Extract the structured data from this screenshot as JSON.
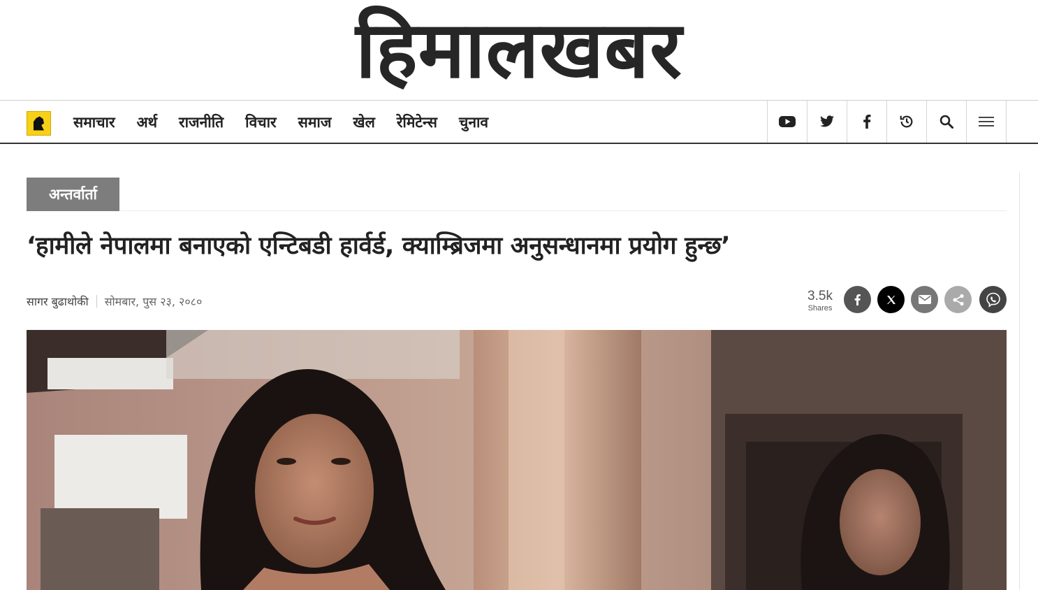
{
  "masthead": {
    "logo_text": "हिमालखबर"
  },
  "nav": {
    "items": [
      "समाचार",
      "अर्थ",
      "राजनीति",
      "विचार",
      "समाज",
      "खेल",
      "रेमिटेन्स",
      "चुनाव"
    ],
    "icons": [
      "youtube-icon",
      "twitter-icon",
      "facebook-icon",
      "history-icon",
      "search-icon",
      "menu-icon"
    ]
  },
  "article": {
    "category": "अन्तर्वार्ता",
    "headline": "‘हामीले नेपालमा बनाएको एन्टिबडी हार्वर्ड, क्याम्ब्रिजमा अनुसन्धानमा प्रयोग हुन्छ’",
    "author": "सागर बुढाथोकी",
    "date": "सोमबार, पुस २३, २०८०"
  },
  "share": {
    "count": "3.5k",
    "label": "Shares",
    "buttons": [
      {
        "name": "facebook-share",
        "color": "#555555"
      },
      {
        "name": "x-share",
        "color": "#000000"
      },
      {
        "name": "email-share",
        "color": "#777777"
      },
      {
        "name": "generic-share",
        "color": "#aaaaaa"
      },
      {
        "name": "viber-share",
        "color": "#444444"
      }
    ]
  },
  "colors": {
    "category_bg": "#7d7d7d",
    "logo_yellow": "#f7d117",
    "text": "#222222"
  }
}
